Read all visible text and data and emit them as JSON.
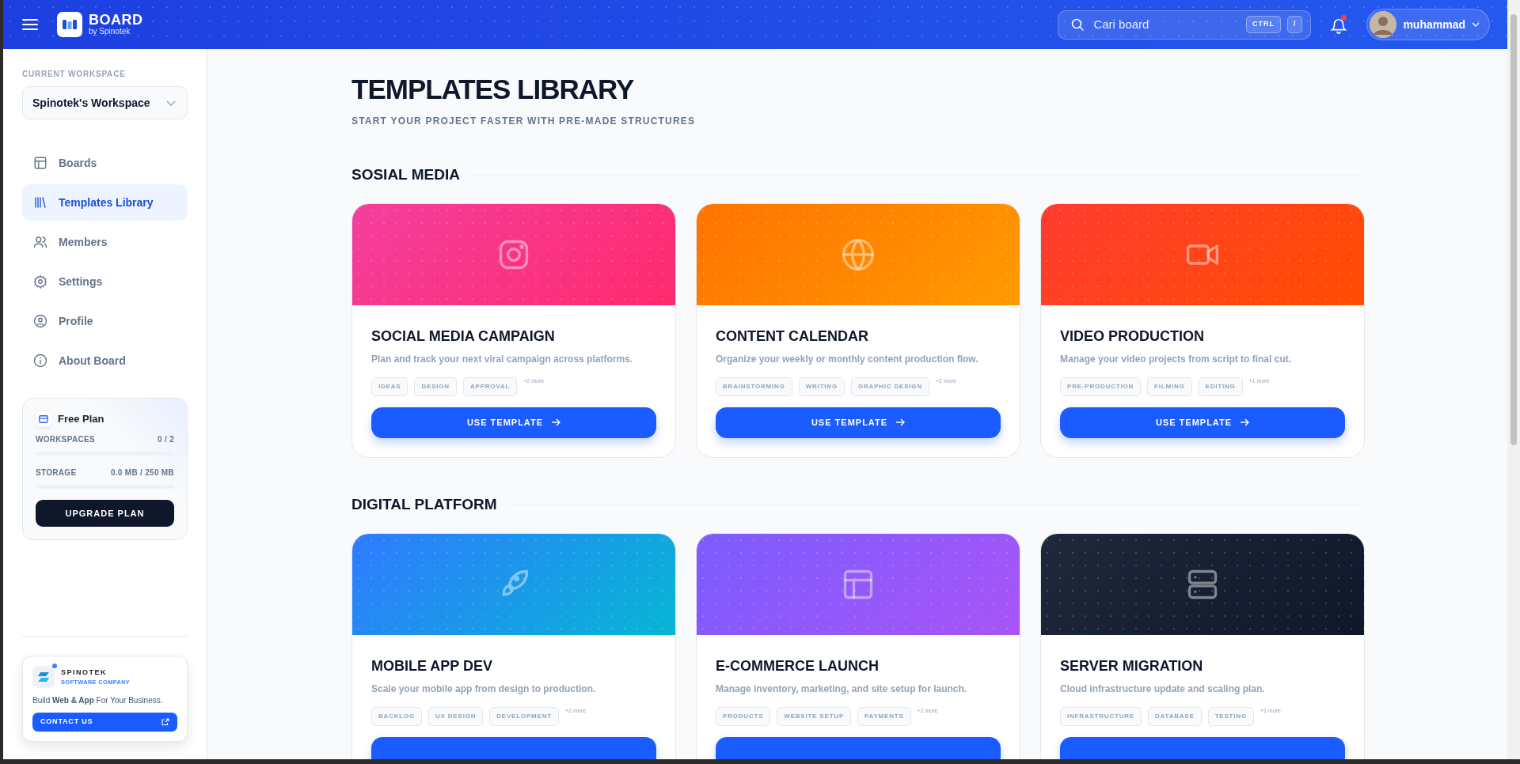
{
  "header": {
    "brand": "BOARD",
    "brand_sub": "by Spinotek",
    "search": {
      "placeholder": "Cari board",
      "keys": [
        "CTRL",
        "/"
      ]
    },
    "notifications": {
      "unread": true
    },
    "user": {
      "name": "muhammad"
    }
  },
  "sidebar": {
    "workspace_label": "CURRENT WORKSPACE",
    "workspace": "Spinotek's Workspace",
    "items": [
      {
        "label": "Boards",
        "selected": false
      },
      {
        "label": "Templates Library",
        "selected": true
      },
      {
        "label": "Members",
        "selected": false
      },
      {
        "label": "Settings",
        "selected": false
      },
      {
        "label": "Profile",
        "selected": false
      },
      {
        "label": "About Board",
        "selected": false
      }
    ],
    "plan": {
      "title": "Free Plan",
      "usage": [
        {
          "label": "WORKSPACES",
          "value": "0 / 2",
          "level": 0
        },
        {
          "label": "STORAGE",
          "value": "0.0 MB / 250 MB",
          "level": 0
        }
      ],
      "button": "UPGRADE PLAN"
    },
    "promo": {
      "name": "SPINOTEK",
      "tagline": "SOFTWARE COMPANY",
      "text": "Build **Web & App** For Your Business.",
      "button": "CONTACT US"
    }
  },
  "page": {
    "title": "TEMPLATES LIBRARY",
    "subtitle": "START YOUR PROJECT FASTER WITH PRE-MADE STRUCTURES"
  },
  "sections": [
    {
      "title": "SOSIAL MEDIA",
      "cards": [
        {
          "title": "SOCIAL MEDIA CAMPAIGN",
          "description": "Plan and track your next viral campaign across platforms.",
          "tags": [
            "IDEAS",
            "DESIGN",
            "APPROVAL"
          ],
          "more": "+2 more",
          "button": "USE TEMPLATE"
        },
        {
          "title": "CONTENT CALENDAR",
          "description": "Organize your weekly or monthly content production flow.",
          "tags": [
            "BRAINSTORMING",
            "WRITING",
            "GRAPHIC DESIGN"
          ],
          "more": "+2 more",
          "button": "USE TEMPLATE"
        },
        {
          "title": "VIDEO PRODUCTION",
          "description": "Manage your video projects from script to final cut.",
          "tags": [
            "PRE-PRODUCTION",
            "FILMING",
            "EDITING"
          ],
          "more": "+1 more",
          "button": "USE TEMPLATE"
        }
      ]
    },
    {
      "title": "DIGITAL PLATFORM",
      "cards": [
        {
          "title": "MOBILE APP DEV",
          "description": "Scale your mobile app from design to production.",
          "tags": [
            "BACKLOG",
            "UX DESIGN",
            "DEVELOPMENT"
          ],
          "more": "+2 more"
        },
        {
          "title": "E-COMMERCE LAUNCH",
          "description": "Manage inventory, marketing, and site setup for launch.",
          "tags": [
            "PRODUCTS",
            "WEBSITE SETUP",
            "PAYMENTS"
          ],
          "more": "+2 more"
        },
        {
          "title": "SERVER MIGRATION",
          "description": "Cloud infrastructure update and scaling plan.",
          "tags": [
            "INFRASTRUCTURE",
            "DATABASE",
            "TESTING"
          ],
          "more": "+1 more"
        }
      ]
    }
  ]
}
